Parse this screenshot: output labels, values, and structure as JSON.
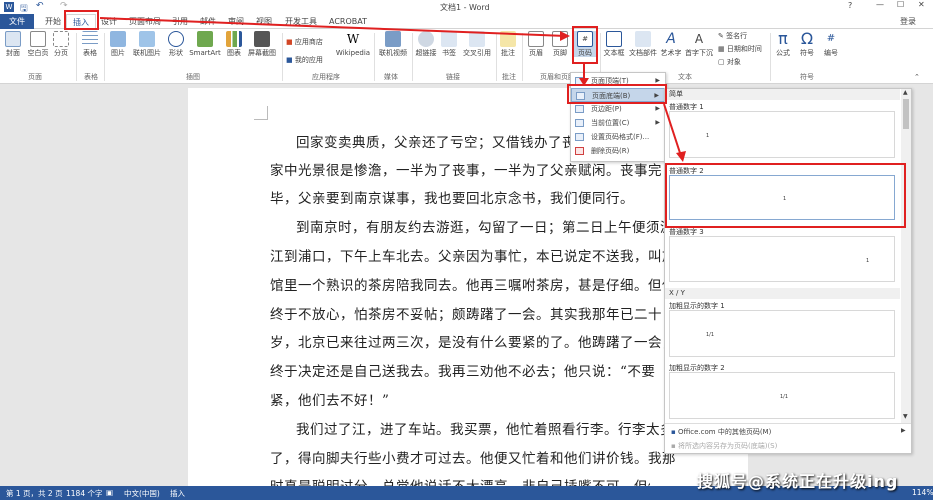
{
  "window": {
    "title": "文档1 - Word",
    "signin": "登录",
    "help": "?",
    "ctrl_min": "—",
    "ctrl_max": "☐",
    "ctrl_close": "✕"
  },
  "tabs": [
    "文件",
    "开始",
    "插入",
    "设计",
    "页面布局",
    "引用",
    "邮件",
    "审阅",
    "视图",
    "开发工具",
    "ACROBAT"
  ],
  "ribbon": {
    "buttons": [
      "封面",
      "空白页",
      "分页",
      "表格",
      "图片",
      "联机图片",
      "形状",
      "SmartArt",
      "图表",
      "屏幕截图",
      "应用商店",
      "我的应用",
      "Wikipedia",
      "联机视频",
      "超链接",
      "书签",
      "交叉引用",
      "批注",
      "页眉",
      "页脚",
      "页码",
      "文本框",
      "文档部件",
      "艺术字",
      "首字下沉",
      "签名行",
      "日期和时间",
      "对象",
      "公式",
      "符号",
      "编号"
    ],
    "groups": [
      "页面",
      "表格",
      "插图",
      "应用程序",
      "媒体",
      "链接",
      "批注",
      "页眉和页脚",
      "文本",
      "符号"
    ]
  },
  "document": {
    "lines": [
      "回家变卖典质，父亲还了亏空；又借钱办了丧事。",
      "家中光景很是惨澹，一半为了丧事，一半为了父亲赋闲。丧事完",
      "毕，父亲要到南京谋事，我也要回北京念书，我们便同行。",
      "到南京时，有朋友约去游逛，勾留了一日；第二日上午便须渡",
      "江到浦口，下午上车北去。父亲因为事忙，本已说定不送我，叫旅",
      "馆里一个熟识的茶房陪我同去。他再三嘱咐茶房，甚是仔细。但他",
      "终于不放心，怕茶房不妥帖；颇踌躇了一会。其实我那年已二十",
      "岁，北京已来往过两三次，是没有什么要紧的了。他踌躇了一会，",
      "终于决定还是自己送我去。我再三劝他不必去；他只说：“不要",
      "紧，他们去不好！”",
      "我们过了江，进了车站。我买票，他忙着照看行李。行李太多",
      "了，得向脚夫行些小费才可过去。他便又忙着和他们讲价钱。我那",
      "时真是聪明过分，总觉他说话不大漂亮，非自己插嘴不可。但他终"
    ]
  },
  "page_number_menu": {
    "items": [
      "页面顶端(T)",
      "页面底端(B)",
      "页边距(P)",
      "当前位置(C)",
      "设置页码格式(F)...",
      "删除页码(R)"
    ]
  },
  "gallery": {
    "section_simple": "简单",
    "items": [
      "普通数字 1",
      "普通数字 2",
      "普通数字 3"
    ],
    "section_xy": "X / Y",
    "bold_items": [
      "加粗显示的数字 1",
      "加粗显示的数字 2"
    ],
    "sample_num": "1",
    "sample_xy": "1/1",
    "more": "Office.com 中的其他页码(M)",
    "save": "将所选内容另存为页码(底端)(S)"
  },
  "status": {
    "page": "第 1 页，共 2 页",
    "words": "1184 个字",
    "lang": "中文(中国)",
    "mode": "插入",
    "zoom": "114%"
  },
  "watermark": "搜狐号@系统正在升级ing"
}
